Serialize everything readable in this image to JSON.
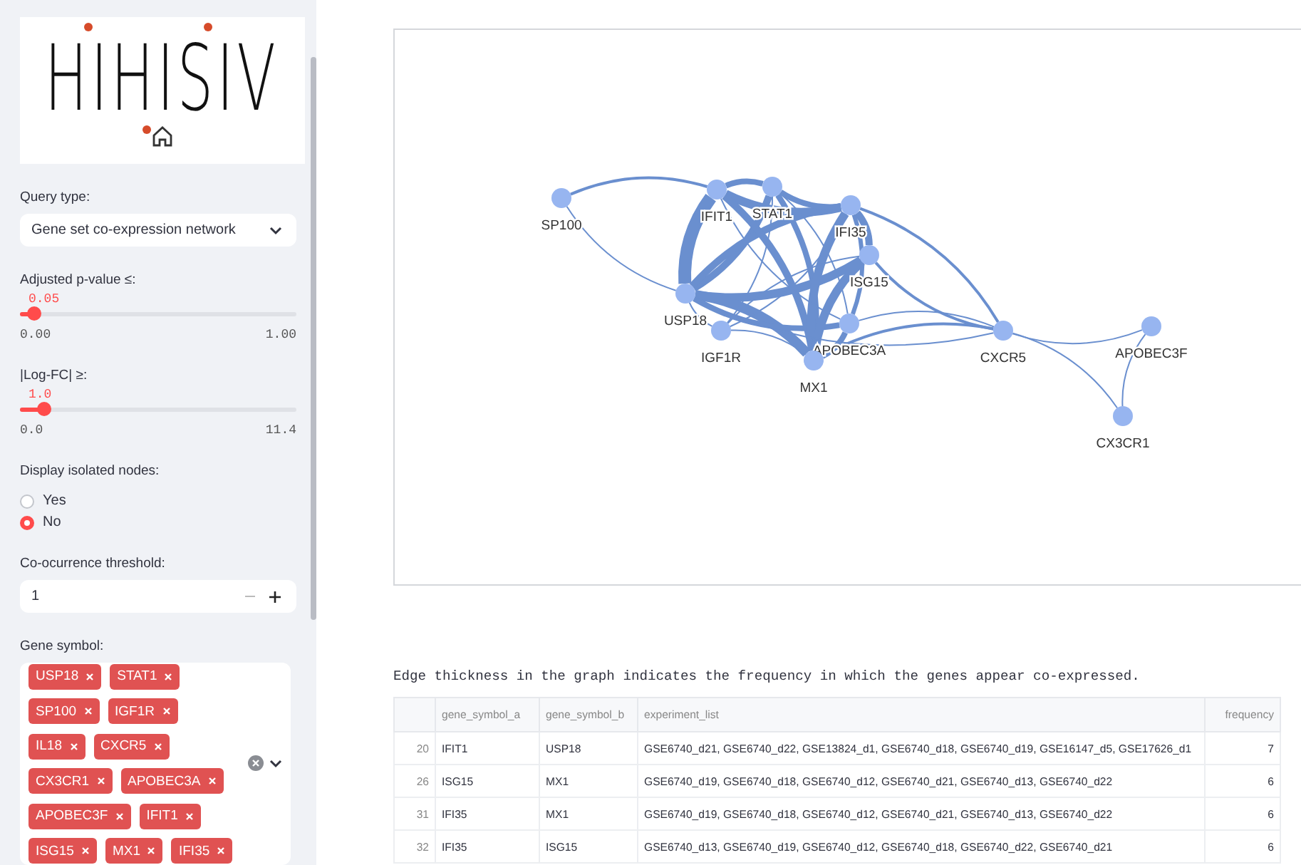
{
  "sidebar": {
    "logo": {
      "text": "HIHISIV"
    },
    "query_type": {
      "label": "Query type:",
      "value": "Gene set co-expression network"
    },
    "sliders": [
      {
        "label": "Adjusted p-value ≤:",
        "reading": "0.05",
        "level": 0.05,
        "min": "0.00",
        "max": "1.00"
      },
      {
        "label": "|Log-FC| ≥:",
        "reading": "1.0",
        "level": 0.088,
        "min": "0.0",
        "max": "11.4"
      }
    ],
    "isolated_nodes": {
      "label": "Display isolated nodes:",
      "options": [
        {
          "label": "Yes",
          "selected": false
        },
        {
          "label": "No",
          "selected": true
        }
      ]
    },
    "threshold": {
      "label": "Co-ocurrence threshold:",
      "value": "1"
    },
    "gene_symbol": {
      "label": "Gene symbol:",
      "tags": [
        [
          "USP18",
          "STAT1"
        ],
        [
          "SP100",
          "IGF1R"
        ],
        [
          "IL18",
          "CXCR5"
        ],
        [
          "CX3CR1",
          "APOBEC3A"
        ],
        [
          "APOBEC3F",
          "IFIT1"
        ],
        [
          "ISG15",
          "MX1",
          "IFI35"
        ]
      ]
    }
  },
  "graph": {
    "nodes": [
      "SP100",
      "IFIT1",
      "STAT1",
      "IFI35",
      "ISG15",
      "USP18",
      "IGF1R",
      "APOBEC3A",
      "MX1",
      "CXCR5",
      "APOBEC3F",
      "CX3CR1"
    ]
  },
  "caption": "Edge thickness in the graph indicates the frequency in which the genes appear co-expressed.",
  "table": {
    "columns": [
      "gene_symbol_a",
      "gene_symbol_b",
      "experiment_list",
      "frequency"
    ],
    "rows": [
      {
        "index": "20",
        "a": "IFIT1",
        "b": "USP18",
        "experiments": "GSE6740_d21, GSE6740_d22, GSE13824_d1, GSE6740_d18, GSE6740_d19, GSE16147_d5, GSE17626_d1",
        "frequency": "7"
      },
      {
        "index": "26",
        "a": "ISG15",
        "b": "MX1",
        "experiments": "GSE6740_d19, GSE6740_d18, GSE6740_d12, GSE6740_d21, GSE6740_d13, GSE6740_d22",
        "frequency": "6"
      },
      {
        "index": "31",
        "a": "IFI35",
        "b": "MX1",
        "experiments": "GSE6740_d19, GSE6740_d18, GSE6740_d12, GSE6740_d21, GSE6740_d13, GSE6740_d22",
        "frequency": "6"
      },
      {
        "index": "32",
        "a": "IFI35",
        "b": "ISG15",
        "experiments": "GSE6740_d13, GSE6740_d19, GSE6740_d12, GSE6740_d18, GSE6740_d22, GSE6740_d21",
        "frequency": "6"
      }
    ]
  }
}
